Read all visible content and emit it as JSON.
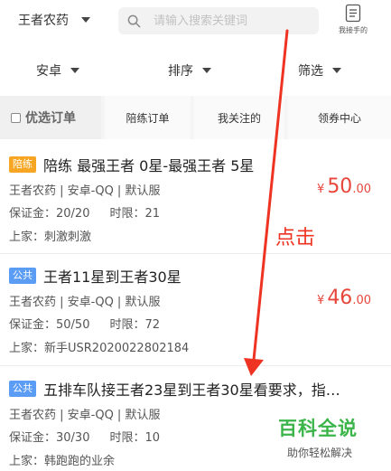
{
  "header": {
    "game": "王者农药",
    "search_placeholder": "请输入搜索关键词",
    "my_search_label": "我接手的"
  },
  "filters": [
    {
      "label": "安卓"
    },
    {
      "label": "排序"
    },
    {
      "label": "筛选"
    }
  ],
  "tabs": [
    {
      "label": "优选订单"
    },
    {
      "label": "陪练订单"
    },
    {
      "label": "我关注的"
    },
    {
      "label": "领券中心"
    }
  ],
  "orders": [
    {
      "tag": "陪练",
      "title": "陪练 最强王者 0星-最强王者 5星",
      "info": "王者农药 | 安卓-QQ | 默认服",
      "deposit": "保证金：20/20",
      "time": "时限：21",
      "seller": "上家：刺激刺激",
      "price_symbol": "¥",
      "price_int": "50",
      "price_dec": ".00"
    },
    {
      "tag": "公共",
      "title": "王者11星到王者30星",
      "info": "王者农药 | 安卓-QQ | 默认服",
      "deposit": "保证金：50/50",
      "time": "时限：72",
      "seller": "上家：新手USR2020022802184",
      "price_symbol": "¥",
      "price_int": "46",
      "price_dec": ".00"
    },
    {
      "tag": "公共",
      "title": "五排车队接王者23星到王者30星看要求，指…",
      "info": "王者农药 | 安卓-QQ | 默认服",
      "deposit": "保证金：30/30",
      "time": "时限：10",
      "seller": "上家：韩跑跑的业余"
    }
  ],
  "annotation": {
    "text": "点击",
    "color": "#ee3322"
  },
  "watermark": {
    "title": "百科全说",
    "subtitle": "助你轻松解决"
  },
  "colors": {
    "price": "#e8463a",
    "tag_orange": "#f6a623",
    "tag_blue": "#5b9cf5",
    "watermark_green": "#3bb54a"
  }
}
